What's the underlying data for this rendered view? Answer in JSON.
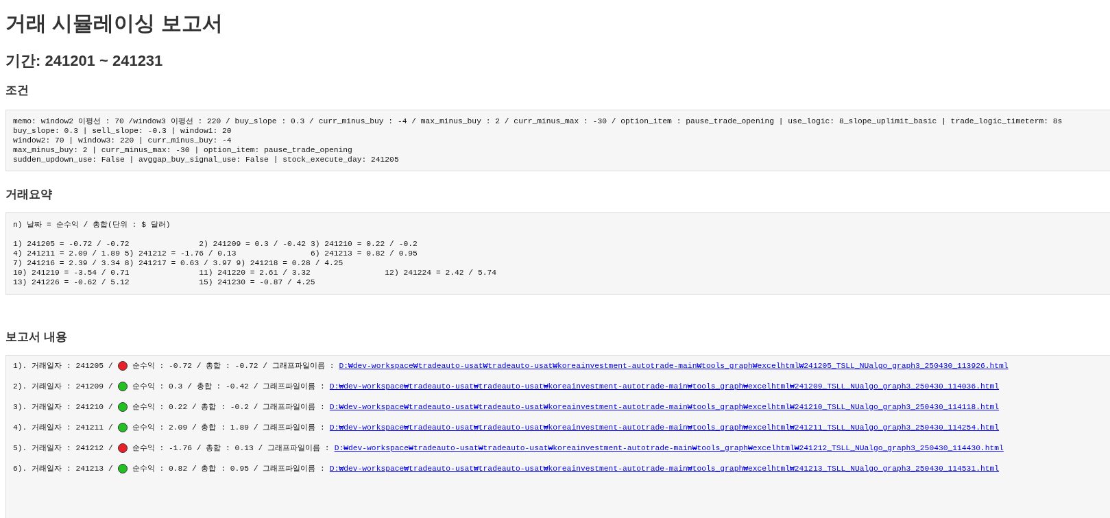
{
  "title": "거래 시뮬레이싱 보고서",
  "period": "기간: 241201 ~ 241231",
  "conditions": {
    "heading": "조건",
    "lines": [
      "memo: window2 이평선 : 70 /window3 이평선 : 220 / buy_slope : 0.3 / curr_minus_buy : -4 / max_minus_buy : 2 / curr_minus_max : -30 / option_item : pause_trade_opening | use_logic: 8_slope_uplimit_basic | trade_logic_timeterm: 8s",
      "buy_slope: 0.3 | sell_slope: -0.3 | window1: 20",
      "window2: 70 | window3: 220 | curr_minus_buy: -4",
      "max_minus_buy: 2 | curr_minus_max: -30 | option_item: pause_trade_opening",
      "sudden_updown_use: False | avggap_buy_signal_use: False | stock_execute_day: 241205"
    ]
  },
  "summary": {
    "heading": "거래요약",
    "legend": "n) 날짜 = 순수익 / 총합(단위 : $ 달러)",
    "lines": [
      "1) 241205 = -0.72 / -0.72\t\t2) 241209 = 0.3 / -0.42\t3) 241210 = 0.22 / -0.2",
      "4) 241211 = 2.09 / 1.89\t5) 241212 = -1.76 / 0.13\t\t6) 241213 = 0.82 / 0.95",
      "7) 241216 = 2.39 / 3.34\t8) 241217 = 0.63 / 3.97\t9) 241218 = 0.28 / 4.25",
      "10) 241219 = -3.54 / 0.71\t\t11) 241220 = 2.61 / 3.32\t\t12) 241224 = 2.42 / 5.74",
      "13) 241226 = -0.62 / 5.12\t\t15) 241230 = -0.87 / 4.25"
    ]
  },
  "report": {
    "heading": "보고서 내용",
    "rows": [
      {
        "before": "1). 거래일자 : 241205 /",
        "color": "#e8202a",
        "after": "순수익 : -0.72 / 총합 : -0.72 / 그래프파일이름 :",
        "link": "D:₩dev-workspace₩tradeauto-usat₩tradeauto-usat₩koreainvestment-autotrade-main₩tools_graph₩excelhtml₩241205_TSLL_NUalgo_graph3_250430_113926.html"
      },
      {
        "before": "2). 거래일자 : 241209 /",
        "color": "#22c022",
        "after": "순수익 : 0.3 / 총합 : -0.42 / 그래프파일이름 :",
        "link": "D:₩dev-workspace₩tradeauto-usat₩tradeauto-usat₩koreainvestment-autotrade-main₩tools_graph₩excelhtml₩241209_TSLL_NUalgo_graph3_250430_114036.html"
      },
      {
        "before": "3). 거래일자 : 241210 /",
        "color": "#22c022",
        "after": "순수익 : 0.22 / 총합 : -0.2 / 그래프파일이름 :",
        "link": "D:₩dev-workspace₩tradeauto-usat₩tradeauto-usat₩koreainvestment-autotrade-main₩tools_graph₩excelhtml₩241210_TSLL_NUalgo_graph3_250430_114118.html"
      },
      {
        "before": "4). 거래일자 : 241211 /",
        "color": "#22c022",
        "after": "순수익 : 2.09 / 총합 : 1.89 / 그래프파일이름 :",
        "link": "D:₩dev-workspace₩tradeauto-usat₩tradeauto-usat₩koreainvestment-autotrade-main₩tools_graph₩excelhtml₩241211_TSLL_NUalgo_graph3_250430_114254.html"
      },
      {
        "before": "5). 거래일자 : 241212 /",
        "color": "#e8202a",
        "after": "순수익 : -1.76 / 총합 : 0.13 / 그래프파일이름 :",
        "link": "D:₩dev-workspace₩tradeauto-usat₩tradeauto-usat₩koreainvestment-autotrade-main₩tools_graph₩excelhtml₩241212_TSLL_NUalgo_graph3_250430_114430.html"
      },
      {
        "before": "6). 거래일자 : 241213 /",
        "color": "#22c022",
        "after": "순수익 : 0.82 / 총합 : 0.95 / 그래프파일이름 :",
        "link": "D:₩dev-workspace₩tradeauto-usat₩tradeauto-usat₩koreainvestment-autotrade-main₩tools_graph₩excelhtml₩241213_TSLL_NUalgo_graph3_250430_114531.html"
      }
    ]
  }
}
